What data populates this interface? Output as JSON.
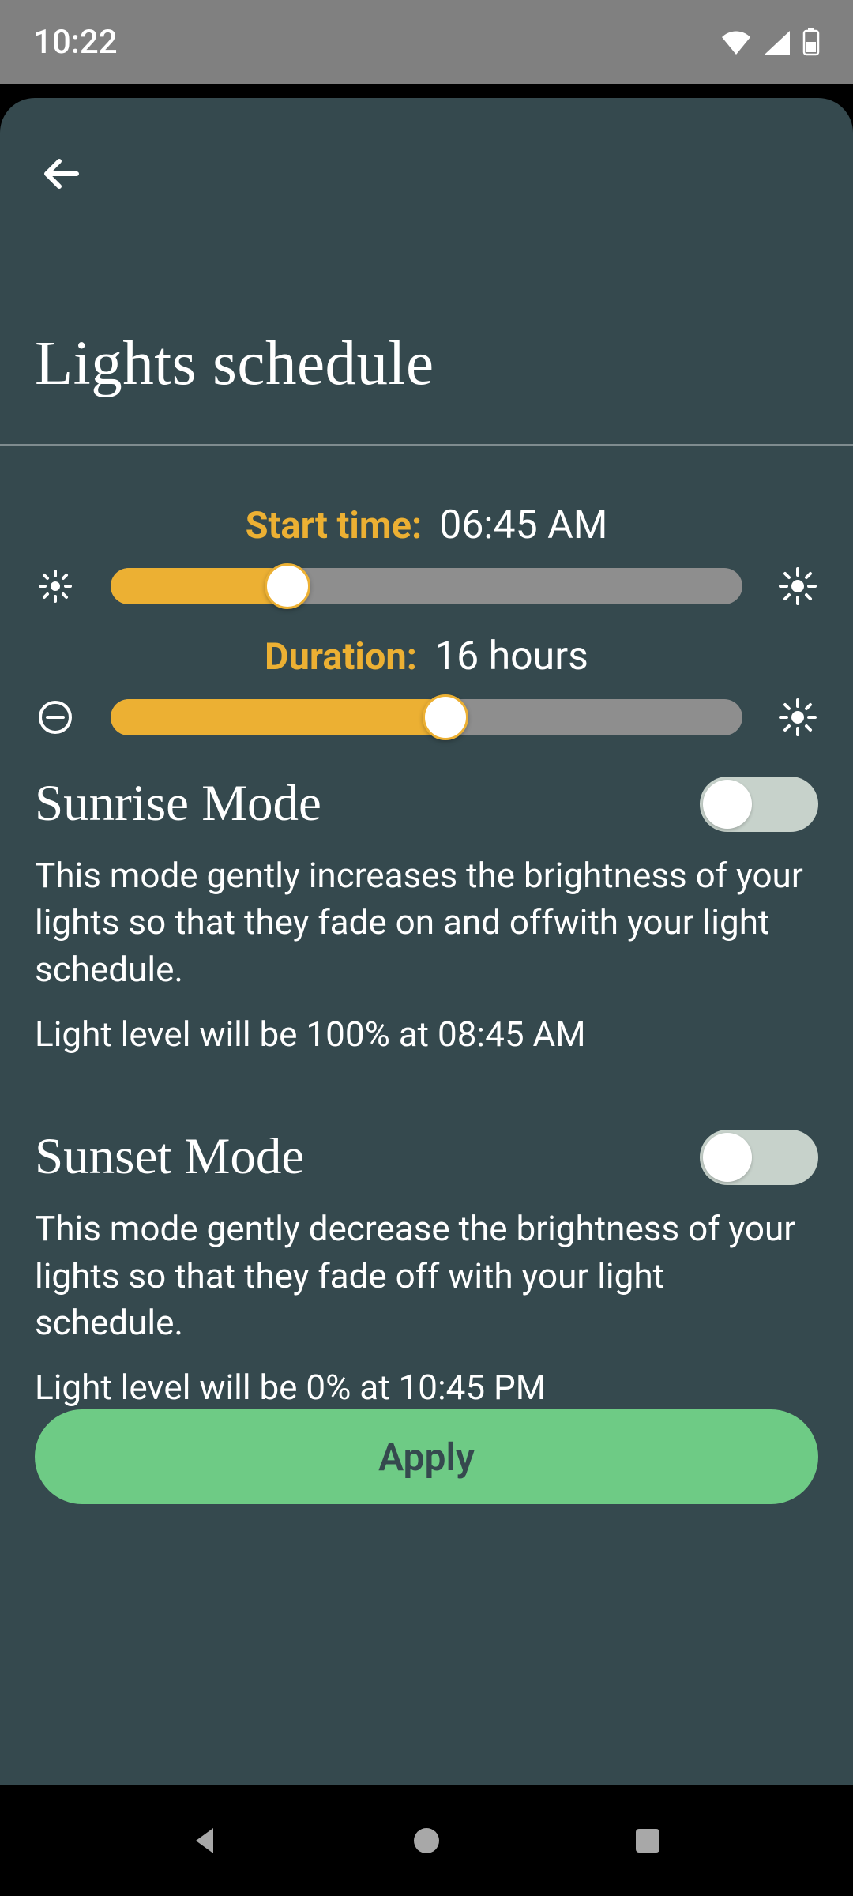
{
  "status": {
    "time": "10:22"
  },
  "page": {
    "title": "Lights schedule"
  },
  "sliders": {
    "start": {
      "label": "Start time:",
      "value": "06:45 AM",
      "percent": 28
    },
    "duration": {
      "label": "Duration:",
      "value": "16 hours",
      "percent": 53
    }
  },
  "modes": {
    "sunrise": {
      "title": "Sunrise Mode",
      "description": "This mode gently increases the brightness of your lights so that they fade on and offwith your light schedule.",
      "info": "Light level will be 100% at 08:45 AM",
      "enabled": false
    },
    "sunset": {
      "title": "Sunset Mode",
      "description": "This mode gently decrease the brightness of your lights so that they fade off with your light schedule.",
      "info": "Light level will be 0% at 10:45 PM",
      "enabled": false
    }
  },
  "actions": {
    "apply": "Apply"
  },
  "colors": {
    "accent": "#ecb033",
    "sheet": "#35494e",
    "apply": "#6ecb85"
  }
}
